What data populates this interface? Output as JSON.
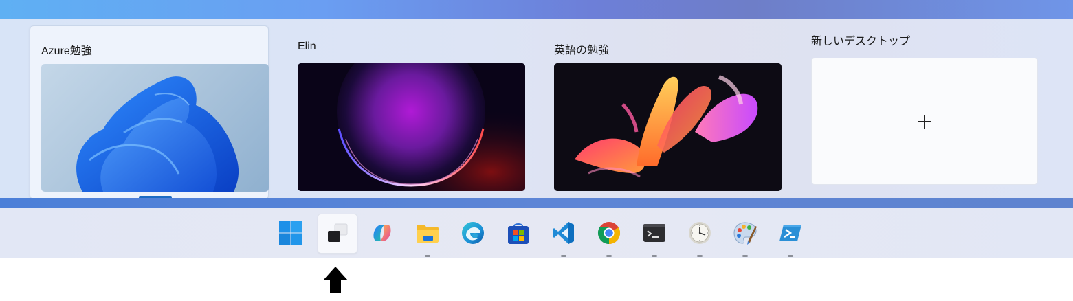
{
  "task_view": {
    "desktops": [
      {
        "name": "Azure勉強",
        "wallpaper": "bloom-blue-wallpaper",
        "selected": true
      },
      {
        "name": "Elin",
        "wallpaper": "purple-glow-wallpaper",
        "selected": false
      },
      {
        "name": "英語の勉強",
        "wallpaper": "colorful-ribbons-wallpaper",
        "selected": false
      }
    ],
    "new_desktop": {
      "label": "新しいデスクトップ",
      "icon": "plus-icon"
    }
  },
  "taskbar": {
    "accent": "#1b6bc4",
    "icons": [
      {
        "name": "start-button",
        "icon": "windows-logo-icon",
        "running": false
      },
      {
        "name": "task-view-button",
        "icon": "task-view-icon",
        "running": false,
        "active": true
      },
      {
        "name": "copilot-button",
        "icon": "copilot-icon",
        "running": false
      },
      {
        "name": "file-explorer-button",
        "icon": "folder-icon",
        "running": true
      },
      {
        "name": "edge-button",
        "icon": "edge-icon",
        "running": false
      },
      {
        "name": "microsoft-store-button",
        "icon": "store-icon",
        "running": false
      },
      {
        "name": "vscode-button",
        "icon": "vscode-icon",
        "running": true
      },
      {
        "name": "chrome-button",
        "icon": "chrome-icon",
        "running": true
      },
      {
        "name": "terminal-button",
        "icon": "terminal-icon",
        "running": true
      },
      {
        "name": "clock-button",
        "icon": "clock-icon",
        "running": true
      },
      {
        "name": "paint-button",
        "icon": "paint-palette-icon",
        "running": true
      },
      {
        "name": "powershell-button",
        "icon": "powershell-icon",
        "running": true
      }
    ]
  },
  "annotation": {
    "icon": "up-arrow-icon"
  }
}
